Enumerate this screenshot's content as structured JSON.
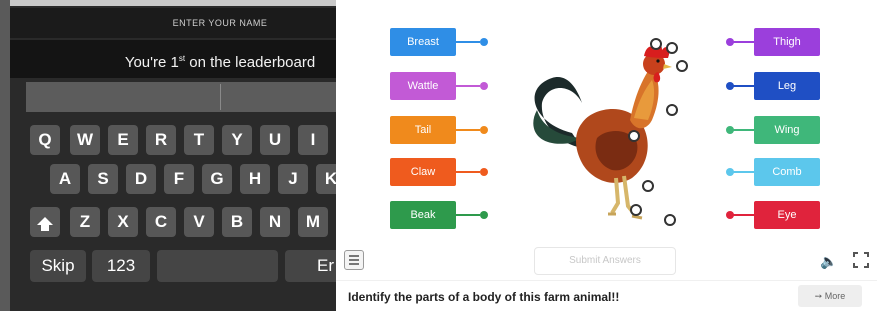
{
  "keyboard": {
    "header": "ENTER YOUR NAME",
    "subtitle_pre": "You're 1",
    "subtitle_sup": "st",
    "subtitle_post": " on the leaderboard",
    "row1": [
      "Q",
      "W",
      "E",
      "R",
      "T",
      "Y",
      "U",
      "I"
    ],
    "row2": [
      "A",
      "S",
      "D",
      "F",
      "G",
      "H",
      "J",
      "K"
    ],
    "row3": [
      "Z",
      "X",
      "C",
      "V",
      "B",
      "N",
      "M"
    ],
    "skip": "Skip",
    "numbers": "123",
    "enter": "Er"
  },
  "quiz": {
    "left_labels": [
      {
        "text": "Breast",
        "color": "#2f8ee6"
      },
      {
        "text": "Wattle",
        "color": "#c25ad6"
      },
      {
        "text": "Tail",
        "color": "#f08a1c"
      },
      {
        "text": "Claw",
        "color": "#ef5b1e"
      },
      {
        "text": "Beak",
        "color": "#2e9a4c"
      }
    ],
    "right_labels": [
      {
        "text": "Thigh",
        "color": "#9b3fdc"
      },
      {
        "text": "Leg",
        "color": "#1f4fc4"
      },
      {
        "text": "Wing",
        "color": "#3fb77a"
      },
      {
        "text": "Comb",
        "color": "#5cc7ec"
      },
      {
        "text": "Eye",
        "color": "#e0233c"
      }
    ],
    "submit_label": "Submit Answers",
    "question": "Identify the parts of a body of this farm animal!!",
    "more_label": "More",
    "sound_icon": "speaker-icon",
    "fullscreen_icon": "fullscreen-icon"
  }
}
